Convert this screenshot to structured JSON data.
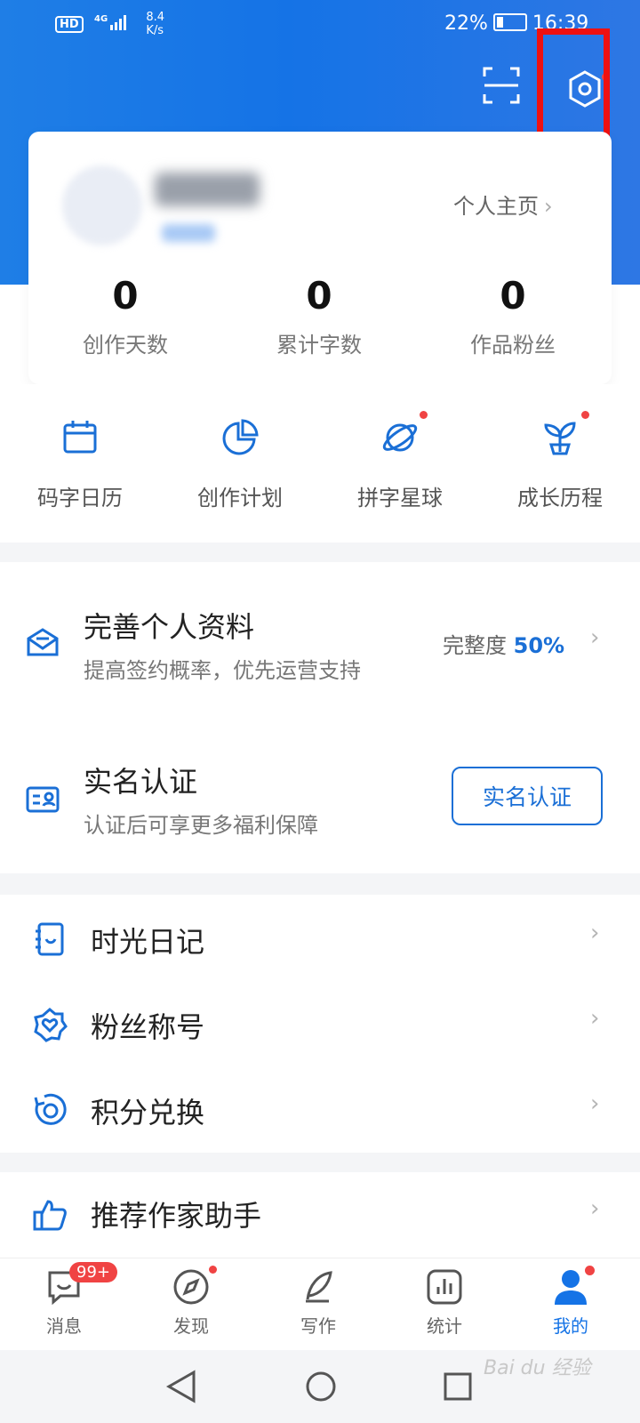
{
  "status_bar": {
    "hd": "HD",
    "network": "4G",
    "speed_value": "8.4",
    "speed_unit": "K/s",
    "battery": "22%",
    "time": "16:39"
  },
  "header": {
    "scan_icon": "scan-icon",
    "settings_icon": "settings-gear-icon"
  },
  "profile": {
    "home_link": "个人主页",
    "stats": [
      {
        "value": "0",
        "label": "创作天数"
      },
      {
        "value": "0",
        "label": "累计字数"
      },
      {
        "value": "0",
        "label": "作品粉丝"
      }
    ]
  },
  "tools": [
    {
      "label": "码字日历",
      "icon": "calendar-icon"
    },
    {
      "label": "创作计划",
      "icon": "pie-chart-icon"
    },
    {
      "label": "拼字星球",
      "icon": "planet-icon"
    },
    {
      "label": "成长历程",
      "icon": "sprout-icon"
    }
  ],
  "complete_profile": {
    "title": "完善个人资料",
    "subtitle": "提高签约概率，优先运营支持",
    "progress_label": "完整度",
    "progress_value": "50%"
  },
  "verification": {
    "title": "实名认证",
    "subtitle": "认证后可享更多福利保障",
    "button": "实名认证"
  },
  "menu": [
    {
      "label": "时光日记",
      "icon": "diary-icon"
    },
    {
      "label": "粉丝称号",
      "icon": "fan-badge-icon"
    },
    {
      "label": "积分兑换",
      "icon": "points-icon"
    }
  ],
  "recommend": {
    "label": "推荐作家助手",
    "icon": "thumbs-up-icon"
  },
  "bottom_nav": [
    {
      "label": "消息",
      "icon": "message-icon",
      "badge": "99+"
    },
    {
      "label": "发现",
      "icon": "compass-icon"
    },
    {
      "label": "写作",
      "icon": "pen-icon"
    },
    {
      "label": "统计",
      "icon": "stats-icon"
    },
    {
      "label": "我的",
      "icon": "user-icon",
      "active": true
    }
  ],
  "colors": {
    "brand": "#1573e6",
    "alert": "#f04343",
    "highlight": "#ee1111"
  },
  "watermark": "Bai du 经验"
}
